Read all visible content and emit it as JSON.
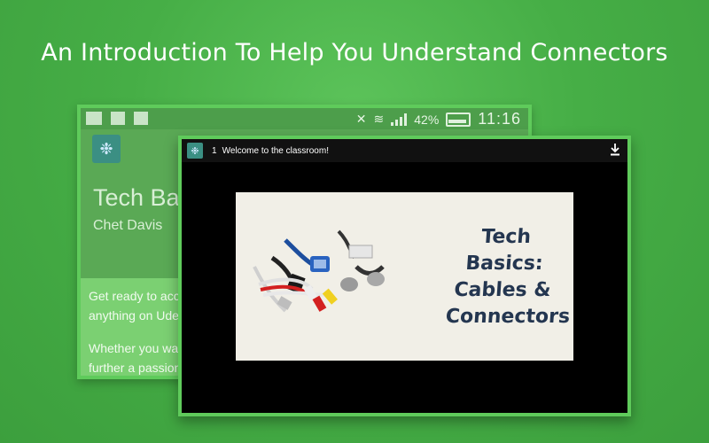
{
  "headline": "An Introduction To Help You Understand Connectors",
  "back_screen": {
    "status_bar": {
      "battery_percent": "42%",
      "time": "11:16"
    },
    "course_title": "Tech Bas",
    "course_author": "Chet Davis",
    "description_line1": "Get ready to acce",
    "description_line2": "anything on Uder",
    "description_line3": "Whether you wan",
    "description_line4": "further a passion,"
  },
  "video_player": {
    "lecture_number": "1",
    "lecture_title": "Welcome to the classroom!",
    "slide_title_line1": "Tech Basics:",
    "slide_title_line2": "Cables &",
    "slide_title_line3": "Connectors",
    "download_icon": "download-icon"
  },
  "colors": {
    "background": "#46ae46",
    "frame_border": "#5fcb5b",
    "slide_text": "#243650"
  }
}
